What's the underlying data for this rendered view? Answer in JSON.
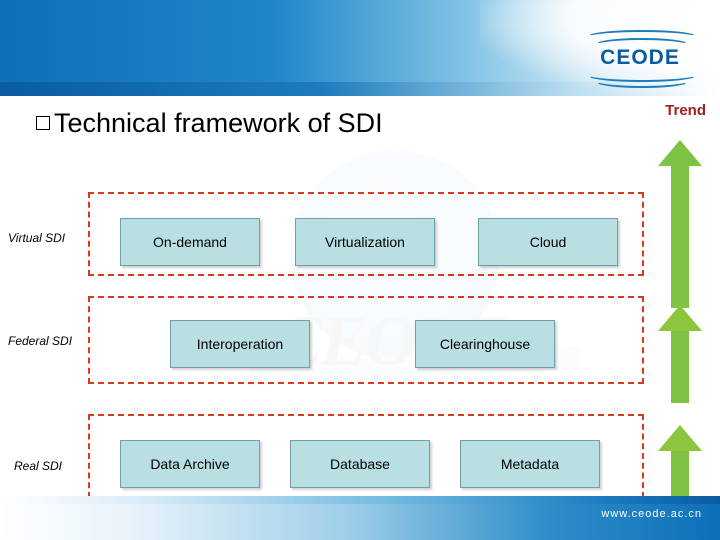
{
  "slide": {
    "title": "Technical framework of SDI",
    "trend_label": "Trend",
    "footer_url": "www.ceode.ac.cn",
    "logo_text": "CEODE",
    "watermark_word": "CEODE"
  },
  "rows": [
    {
      "label": "Virtual  SDI",
      "items": [
        "On-demand",
        "Virtualization",
        "Cloud"
      ]
    },
    {
      "label": "Federal  SDI",
      "items": [
        "Interoperation",
        "Clearinghouse"
      ]
    },
    {
      "label": "Real SDI",
      "items": [
        "Data Archive",
        "Database",
        "Metadata"
      ]
    }
  ],
  "colors": {
    "accent_blue": "#0d6fb8",
    "box_fill": "#b9dfe3",
    "dashed_border": "#d93a1f",
    "arrow_green": "#7dc243",
    "trend_text": "#a02020"
  }
}
